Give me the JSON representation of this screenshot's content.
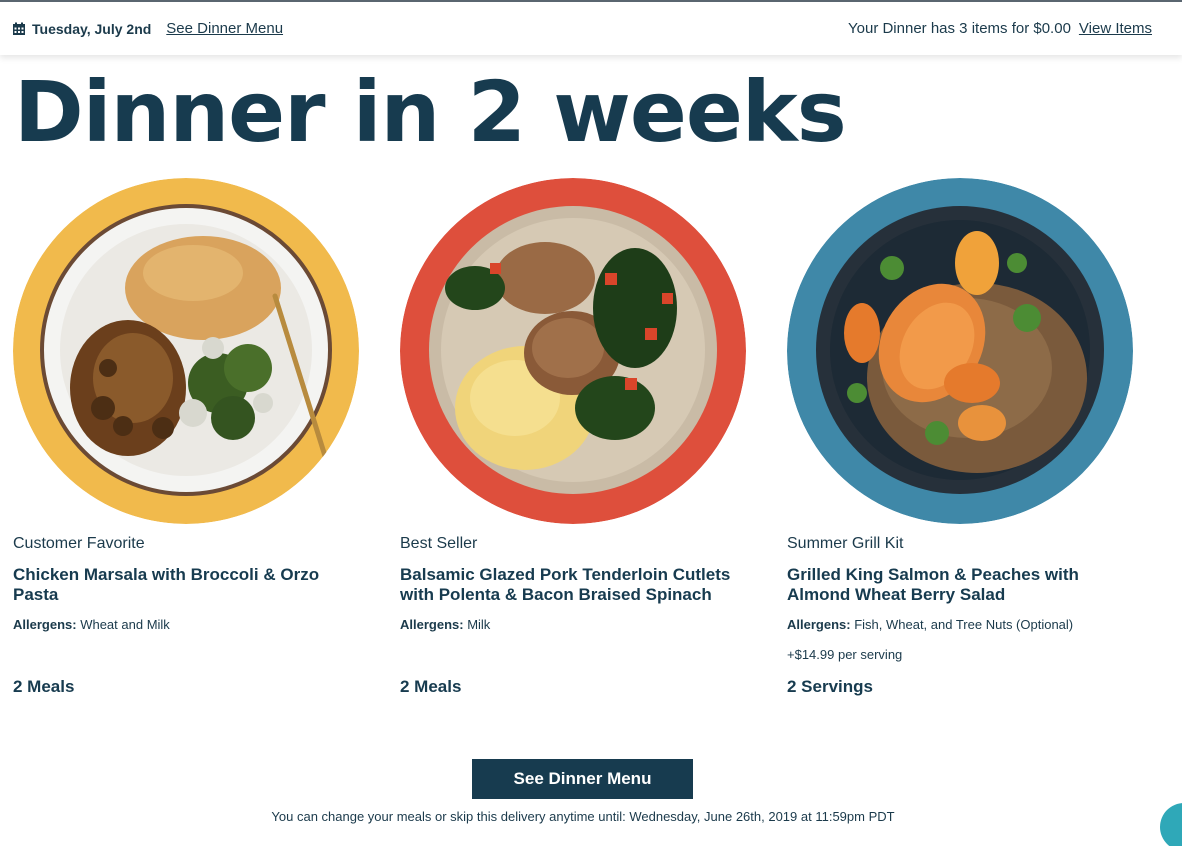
{
  "header": {
    "date": "Tuesday, July 2nd",
    "see_menu_link": "See Dinner Menu",
    "summary": "Your Dinner has 3 items for $0.00",
    "view_items_link": "View Items"
  },
  "page_title": "Dinner in 2 weeks",
  "cards": [
    {
      "tag": "Customer Favorite",
      "title": "Chicken Marsala with Broccoli & Orzo Pasta",
      "allergens_label": "Allergens:",
      "allergens": "Wheat and Milk",
      "extra": "",
      "quantity": "2 Meals",
      "circle_color": "#f1ba4c"
    },
    {
      "tag": "Best Seller",
      "title": "Balsamic Glazed Pork Tenderloin Cutlets with Polenta & Bacon Braised Spinach",
      "allergens_label": "Allergens:",
      "allergens": "Milk",
      "extra": "",
      "quantity": "2 Meals",
      "circle_color": "#de4f3c"
    },
    {
      "tag": "Summer Grill Kit",
      "title": "Grilled King Salmon & Peaches with Almond Wheat Berry Salad",
      "allergens_label": "Allergens:",
      "allergens": "Fish, Wheat, and Tree Nuts (Optional)",
      "extra": "+$14.99 per serving",
      "quantity": "2 Servings",
      "circle_color": "#3f88a8"
    }
  ],
  "cta_label": "See Dinner Menu",
  "notice": "You can change your meals or skip this delivery anytime until: Wednesday, June 26th, 2019 at 11:59pm PDT",
  "colors": {
    "navy": "#173b4f",
    "chat": "#2fa8b8"
  },
  "icons": {
    "calendar": "calendar-icon",
    "chat": "chat-icon"
  }
}
